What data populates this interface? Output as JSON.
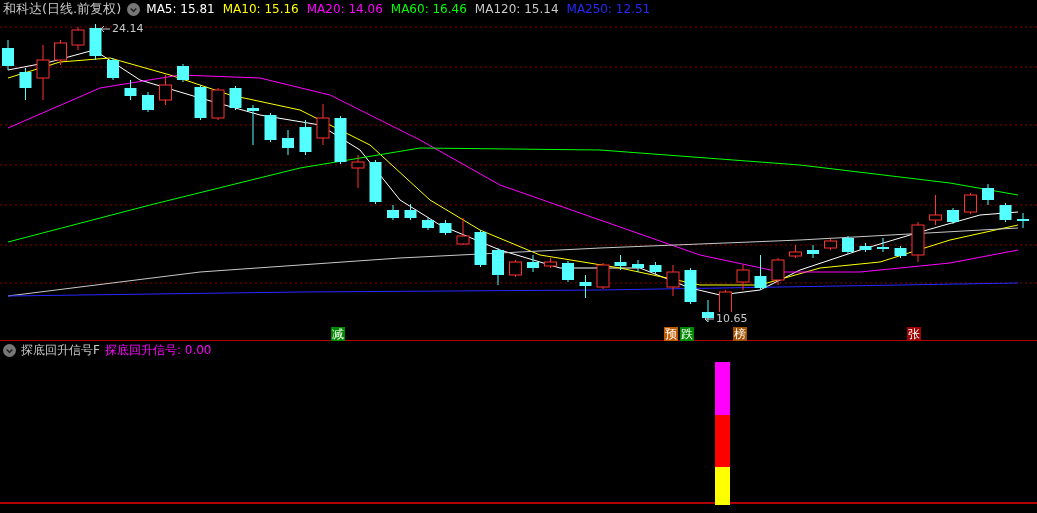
{
  "title": "和科达(日线.前复权)",
  "ma_legend": [
    {
      "label": "MA5: 15.81",
      "color": "#ffffff"
    },
    {
      "label": "MA10: 15.16",
      "color": "#ffff00"
    },
    {
      "label": "MA20: 14.06",
      "color": "#ff00ff"
    },
    {
      "label": "MA60: 16.46",
      "color": "#00ff00"
    },
    {
      "label": "MA120: 15.14",
      "color": "#c8c8c8"
    },
    {
      "label": "MA250: 12.51",
      "color": "#2828ff"
    }
  ],
  "price_marks": [
    {
      "text": "24.14",
      "kind": "high"
    },
    {
      "text": "10.65",
      "kind": "low"
    }
  ],
  "signal_tags": [
    {
      "text": "减",
      "color": "#008a00"
    },
    {
      "text": "预",
      "color": "#c05a00"
    },
    {
      "text": "跌",
      "color": "#008a00"
    },
    {
      "text": "榜",
      "color": "#a05000"
    },
    {
      "text": "张",
      "color": "#a00000"
    }
  ],
  "indicator": {
    "title": "探底回升信号F",
    "reading": "探底回升信号: 0.00"
  }
}
